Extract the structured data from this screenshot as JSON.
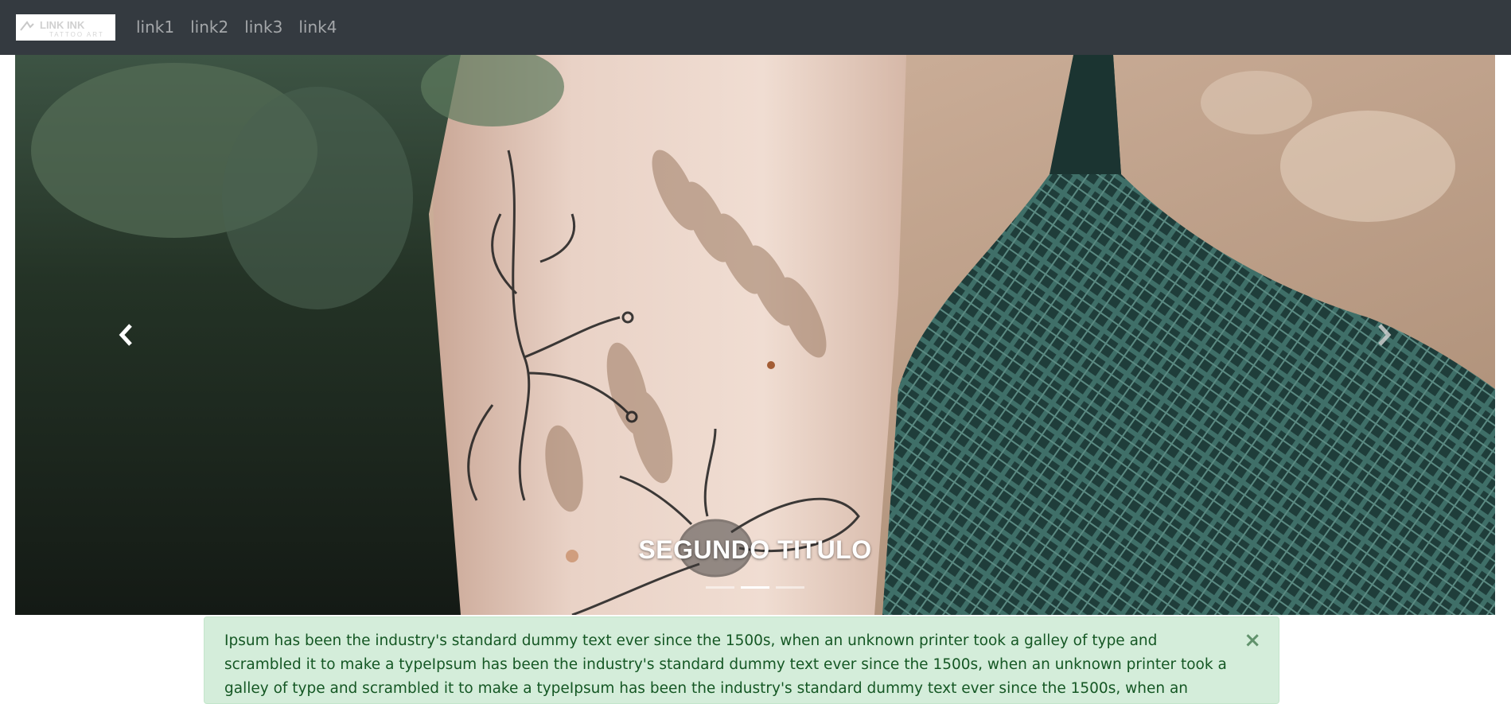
{
  "navbar": {
    "logo": {
      "line1": "LINK INK",
      "line2": "TATTOO ART"
    },
    "links": [
      "link1",
      "link2",
      "link3",
      "link4"
    ]
  },
  "carousel": {
    "caption": "SEGUNDO TITULO",
    "indicator_count": 3,
    "active_index": 1,
    "prev_icon": "chevron-left-icon",
    "next_icon": "chevron-right-icon"
  },
  "alert": {
    "text": "Ipsum has been the industry's standard dummy text ever since the 1500s, when an unknown printer took a galley of type and scrambled it to make a typeIpsum has been the industry's standard dummy text ever since the 1500s, when an unknown printer took a galley of type and scrambled it to make a typeIpsum has been the industry's standard dummy text ever since the 1500s, when an unknown printer took a galley of type and scrambled it to make a type",
    "close_label": "×"
  },
  "colors": {
    "navbar_bg": "#343a40",
    "alert_bg": "#d4edda",
    "alert_text": "#155724"
  }
}
